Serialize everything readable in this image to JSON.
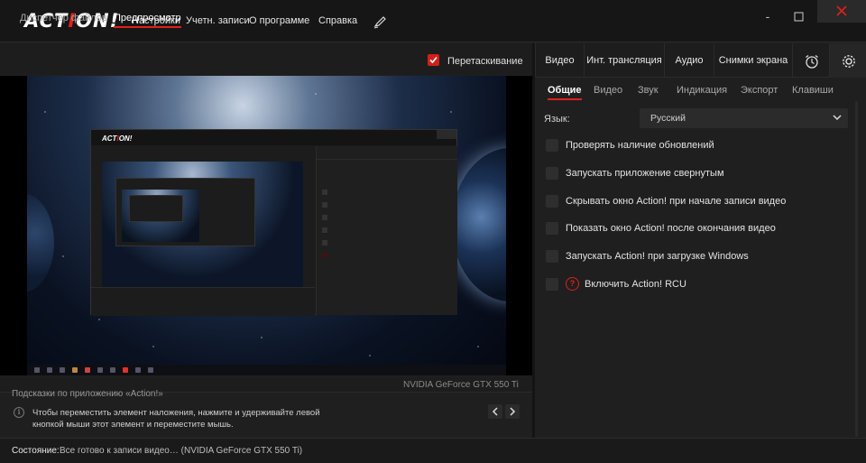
{
  "app": {
    "menu": [
      "Настройки",
      "Учетн. записи",
      "О программе",
      "Справка"
    ],
    "window_min": "-"
  },
  "left": {
    "tabs": [
      "Диспетчер файлов",
      "Предпросмотр"
    ],
    "active_tab": 1,
    "drag_label": "Перетаскивание",
    "drag_checked": true,
    "gpu": "NVIDIA GeForce GTX 550 Ti",
    "hint_title": "Подсказки по приложению «Action!»",
    "hint_text": "Чтобы переместить элемент наложения, нажмите и удерживайте левой кнопкой мыши этот элемент и переместите мышь."
  },
  "status": {
    "label": "Состояние:",
    "text": "Все готово к записи видео… (NVIDIA GeForce GTX 550 Ti)"
  },
  "right": {
    "tabs": [
      "Видео",
      "Инт. трансляция",
      "Аудио",
      "Снимки экрана"
    ],
    "subtabs": [
      "Общие",
      "Видео",
      "Звук",
      "Индикация",
      "Экспорт",
      "Клавиши"
    ],
    "active_subtab": 0,
    "language_label": "Язык:",
    "language_value": "Русский",
    "options": [
      {
        "label": "Проверять наличие обновлений",
        "checked": false
      },
      {
        "label": "Запускать приложение свернутым",
        "checked": false
      },
      {
        "label": "Скрывать окно Action! при начале записи видео",
        "checked": false
      },
      {
        "label": "Показать окно Action! после окончания видео",
        "checked": false
      },
      {
        "label": "Запускать Action! при загрузке Windows",
        "checked": false
      },
      {
        "label": "Включить Action! RCU",
        "checked": false,
        "warning": true
      }
    ]
  },
  "colors": {
    "accent": "#e0201b",
    "background": "#1f1f1f",
    "titlebar": "#161616"
  },
  "icons": [
    "pen-icon",
    "minimize-icon",
    "maximize-icon",
    "close-icon",
    "alarm-clock-icon",
    "gear-icon",
    "info-icon",
    "chevron-left-icon",
    "chevron-right-icon",
    "chevron-down-icon",
    "warning-icon",
    "checkmark-icon"
  ]
}
